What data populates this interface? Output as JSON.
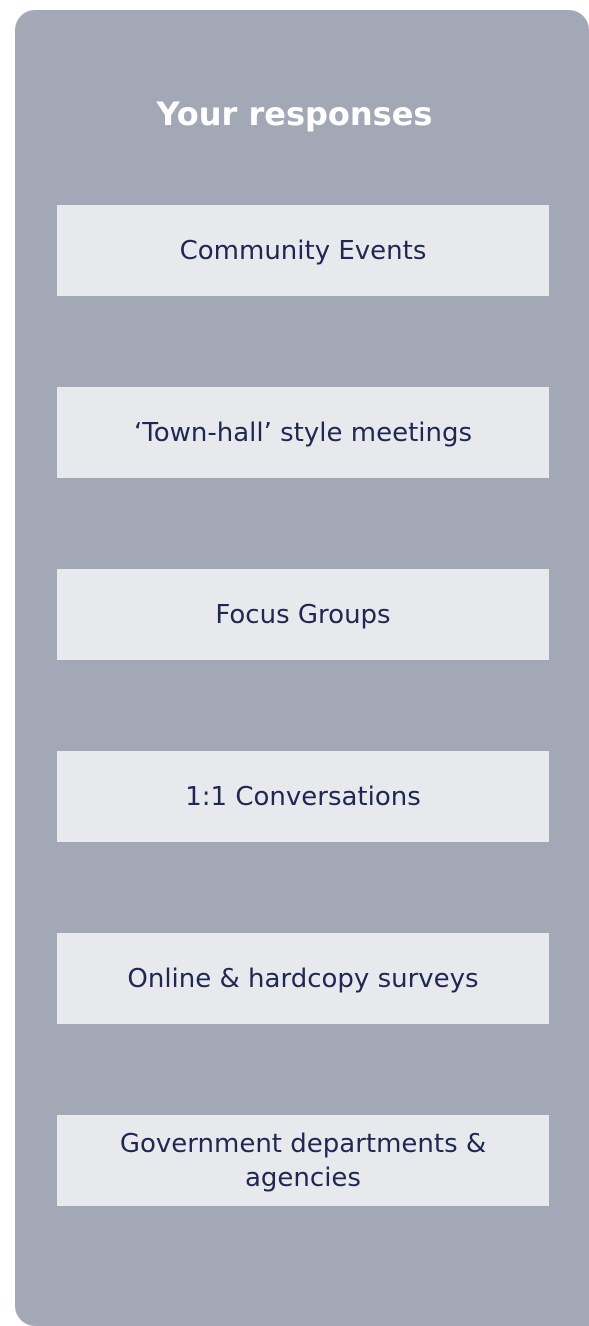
{
  "panel": {
    "title": "Your responses",
    "items": [
      {
        "label": "Community Events"
      },
      {
        "label": "‘Town-hall’ style meetings"
      },
      {
        "label": "Focus Groups"
      },
      {
        "label": "1:1 Conversations"
      },
      {
        "label": "Online & hardcopy surveys"
      },
      {
        "label": "Government departments & agencies"
      }
    ]
  },
  "colors": {
    "panel_background": "#a3a8b7",
    "item_background": "#e8e9ed",
    "item_text": "#1f2752",
    "title_text": "#ffffff"
  }
}
